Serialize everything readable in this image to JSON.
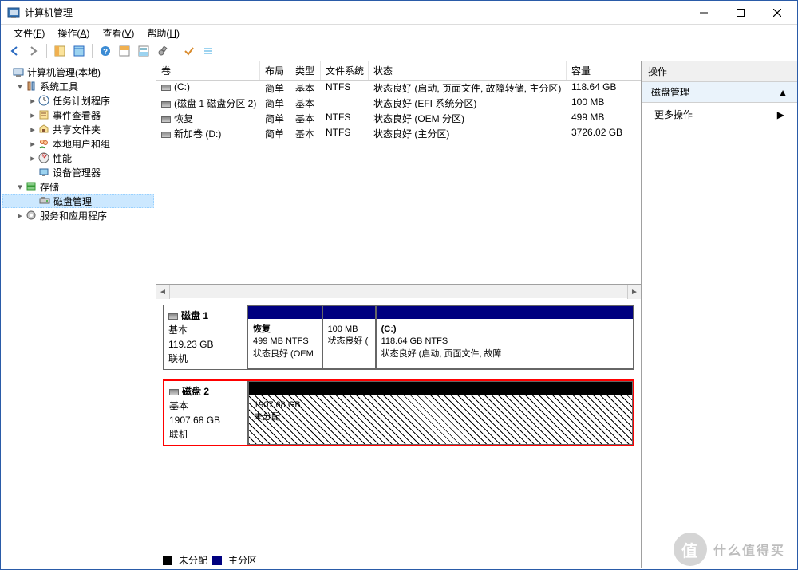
{
  "title": "计算机管理",
  "menubar": [
    {
      "label": "文件",
      "accel": "F"
    },
    {
      "label": "操作",
      "accel": "A"
    },
    {
      "label": "查看",
      "accel": "V"
    },
    {
      "label": "帮助",
      "accel": "H"
    }
  ],
  "tree": {
    "root": "计算机管理(本地)",
    "system_tools": "系统工具",
    "task_scheduler": "任务计划程序",
    "event_viewer": "事件查看器",
    "shared_folders": "共享文件夹",
    "local_users": "本地用户和组",
    "performance": "性能",
    "device_manager": "设备管理器",
    "storage": "存储",
    "disk_mgmt": "磁盘管理",
    "services_apps": "服务和应用程序"
  },
  "vol_headers": {
    "vol": "卷",
    "layout": "布局",
    "type": "类型",
    "fs": "文件系统",
    "status": "状态",
    "capacity": "容量"
  },
  "volumes": [
    {
      "name": "(C:)",
      "layout": "简单",
      "type": "基本",
      "fs": "NTFS",
      "status": "状态良好 (启动, 页面文件, 故障转储, 主分区)",
      "capacity": "118.64 GB"
    },
    {
      "name": "(磁盘 1 磁盘分区 2)",
      "layout": "简单",
      "type": "基本",
      "fs": "",
      "status": "状态良好 (EFI 系统分区)",
      "capacity": "100 MB"
    },
    {
      "name": "恢复",
      "layout": "简单",
      "type": "基本",
      "fs": "NTFS",
      "status": "状态良好 (OEM 分区)",
      "capacity": "499 MB"
    },
    {
      "name": "新加卷 (D:)",
      "layout": "简单",
      "type": "基本",
      "fs": "NTFS",
      "status": "状态良好 (主分区)",
      "capacity": "3726.02 GB"
    }
  ],
  "disks": [
    {
      "name": "磁盘 1",
      "type": "基本",
      "size": "119.23 GB",
      "status": "联机",
      "highlight": false,
      "parts": [
        {
          "title": "恢复",
          "line2": "499 MB NTFS",
          "line3": "状态良好 (OEM",
          "bar": "blue",
          "pct": 18
        },
        {
          "title": "",
          "line2": "100 MB",
          "line3": "状态良好 (",
          "bar": "blue",
          "pct": 12
        },
        {
          "title": "(C:)",
          "line2": "118.64 GB NTFS",
          "line3": "状态良好 (启动, 页面文件, 故障",
          "bar": "blue",
          "pct": 70
        }
      ]
    },
    {
      "name": "磁盘 2",
      "type": "基本",
      "size": "1907.68 GB",
      "status": "联机",
      "highlight": true,
      "parts": [
        {
          "title": "",
          "line2": "1907.68 GB",
          "line3": "未分配",
          "bar": "black",
          "pct": 100,
          "hatch": true
        }
      ]
    }
  ],
  "legend": {
    "unalloc": "未分配",
    "primary": "主分区"
  },
  "rightpane": {
    "header": "操作",
    "section": "磁盘管理",
    "more": "更多操作"
  },
  "watermark": "什么值得买"
}
